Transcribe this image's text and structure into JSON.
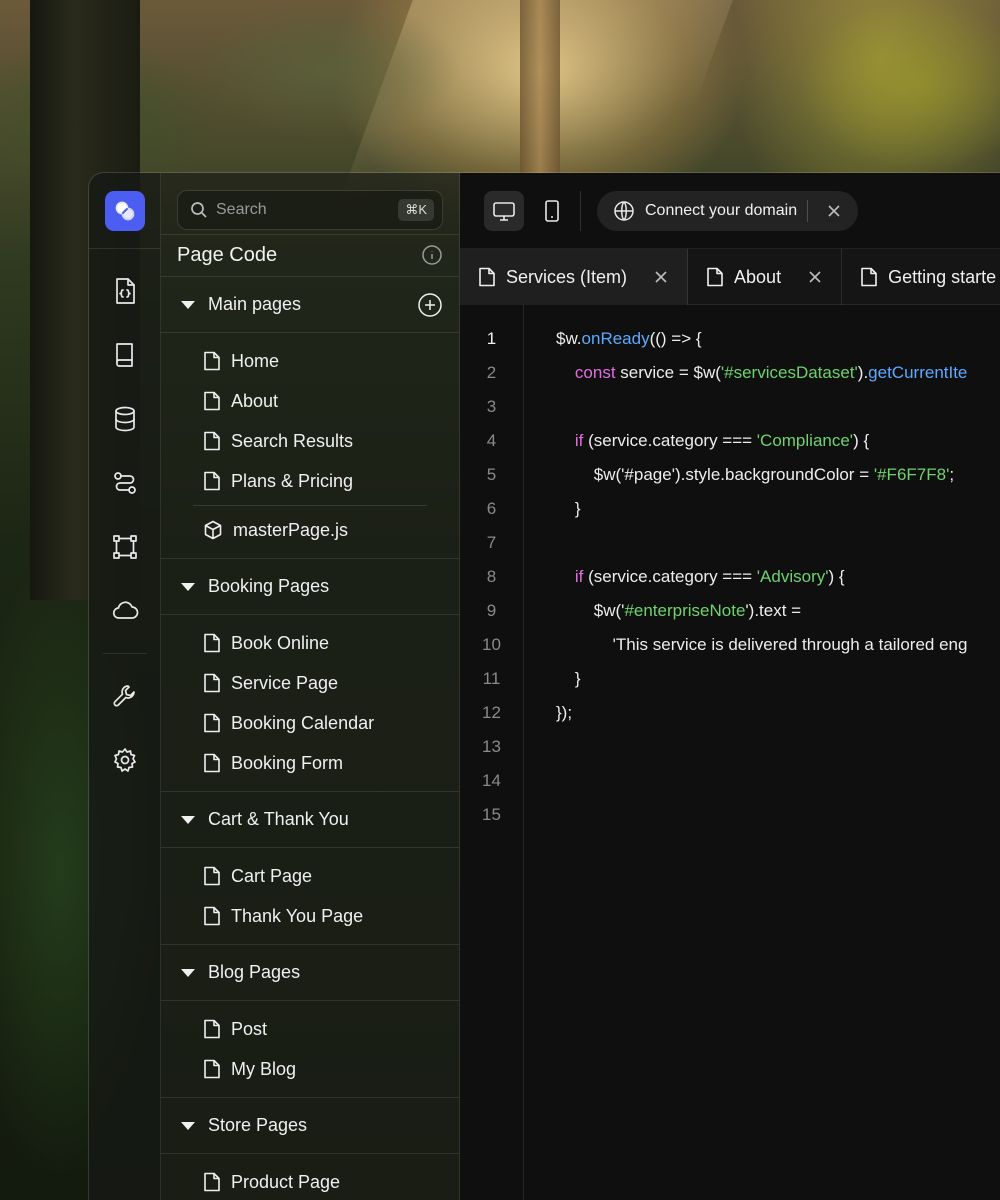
{
  "search": {
    "placeholder": "Search",
    "shortcut": "⌘K"
  },
  "sidebar": {
    "title": "Page Code",
    "groups": [
      {
        "label": "Main pages",
        "items": [
          "Home",
          "About",
          "Search Results",
          "Plans & Pricing"
        ],
        "extra": "masterPage.js"
      },
      {
        "label": "Booking Pages",
        "items": [
          "Book Online",
          "Service Page",
          "Booking Calendar",
          "Booking Form"
        ]
      },
      {
        "label": "Cart & Thank You",
        "items": [
          "Cart Page",
          "Thank You Page"
        ]
      },
      {
        "label": "Blog Pages",
        "items": [
          "Post",
          "My Blog"
        ]
      },
      {
        "label": "Store Pages",
        "items": [
          "Product Page"
        ]
      }
    ]
  },
  "toolbar": {
    "domain_label": "Connect your domain"
  },
  "tabs": [
    {
      "label": "Services (Item)",
      "active": true
    },
    {
      "label": "About",
      "active": false
    },
    {
      "label": "Getting starte",
      "active": false
    }
  ],
  "editor": {
    "current_line": 1,
    "line_numbers": [
      "1",
      "2",
      "3",
      "4",
      "5",
      "6",
      "7",
      "8",
      "9",
      "10",
      "11",
      "12",
      "13",
      "14",
      "15"
    ],
    "lines": [
      [
        [
          "p",
          "$w."
        ],
        [
          "fn",
          "onReady"
        ],
        [
          "p",
          "(() => {"
        ]
      ],
      [
        [
          "p",
          "    "
        ],
        [
          "kw",
          "const"
        ],
        [
          "p",
          " service = $w("
        ],
        [
          "str",
          "'#servicesDataset'"
        ],
        [
          "p",
          ")."
        ],
        [
          "fn",
          "getCurrentIte"
        ]
      ],
      [],
      [
        [
          "p",
          "    "
        ],
        [
          "kw",
          "if"
        ],
        [
          "p",
          " (service.category === "
        ],
        [
          "str",
          "'Compliance'"
        ],
        [
          "p",
          ") {"
        ]
      ],
      [
        [
          "p",
          "        $w('#page').style.backgroundColor = "
        ],
        [
          "str",
          "'#F6F7F8'"
        ],
        [
          "p",
          ";"
        ]
      ],
      [
        [
          "p",
          "    }"
        ]
      ],
      [],
      [
        [
          "p",
          "    "
        ],
        [
          "kw",
          "if"
        ],
        [
          "p",
          " (service.category === "
        ],
        [
          "str",
          "'Advisory'"
        ],
        [
          "p",
          ") {"
        ]
      ],
      [
        [
          "p",
          "        $w('"
        ],
        [
          "str",
          "#enterpriseNote"
        ],
        [
          "p",
          "').text ="
        ]
      ],
      [
        [
          "p",
          "            'This service is delivered through a tailored eng"
        ]
      ],
      [
        [
          "p",
          "    }"
        ]
      ],
      [
        [
          "p",
          "});"
        ]
      ],
      [],
      [],
      []
    ]
  },
  "colors": {
    "accent": "#4c5ef2",
    "keyword": "#e06ee0",
    "function": "#5ea8ff",
    "string": "#6ed36e",
    "editor_bg": "#0f0f0f"
  },
  "icons": {
    "rail": [
      "code-file-icon",
      "book-icon",
      "database-icon",
      "flow-icon",
      "selection-frame-icon",
      "cloud-icon",
      "wrench-icon",
      "gear-icon"
    ]
  }
}
